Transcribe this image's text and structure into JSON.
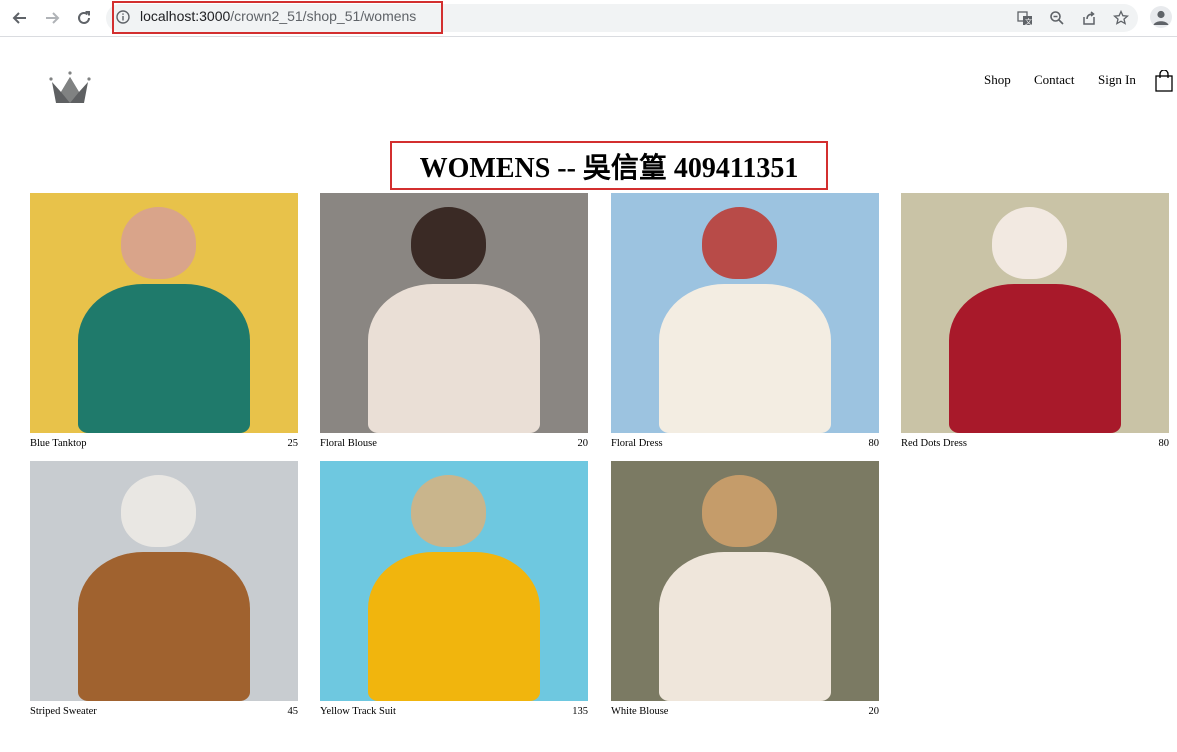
{
  "browser": {
    "url_host": "localhost:3000",
    "url_path": "/crown2_51/shop_51/womens",
    "icons": [
      "back-icon",
      "forward-icon",
      "reload-icon",
      "info-icon",
      "translate-icon",
      "zoom-icon",
      "share-icon",
      "bookmark-star-icon",
      "profile-icon"
    ]
  },
  "header": {
    "logo_icon": "crown-logo-icon",
    "nav": [
      {
        "label": "Shop"
      },
      {
        "label": "Contact"
      },
      {
        "label": "Sign In"
      }
    ],
    "cart_icon": "shopping-bag-icon"
  },
  "page": {
    "title": "WOMENS -- 吳信篁 409411351"
  },
  "items": [
    {
      "name": "Blue Tanktop",
      "price": "25",
      "palette": [
        "#e8c24a",
        "#1f7a6b",
        "#d9a48a"
      ]
    },
    {
      "name": "Floral Blouse",
      "price": "20",
      "palette": [
        "#8a8682",
        "#eadfd6",
        "#3a2a25"
      ]
    },
    {
      "name": "Floral Dress",
      "price": "80",
      "palette": [
        "#9cc3e0",
        "#f3ede2",
        "#b84b48"
      ]
    },
    {
      "name": "Red Dots Dress",
      "price": "80",
      "palette": [
        "#c9c3a6",
        "#a8192a",
        "#f2e9e1"
      ]
    },
    {
      "name": "Striped Sweater",
      "price": "45",
      "palette": [
        "#c8ccd0",
        "#a0622f",
        "#e9e7e3"
      ]
    },
    {
      "name": "Yellow Track Suit",
      "price": "135",
      "palette": [
        "#6ec8e0",
        "#f1b50d",
        "#c9b58c"
      ]
    },
    {
      "name": "White Blouse",
      "price": "20",
      "palette": [
        "#7b7a63",
        "#efe6db",
        "#c59c6a"
      ]
    }
  ]
}
